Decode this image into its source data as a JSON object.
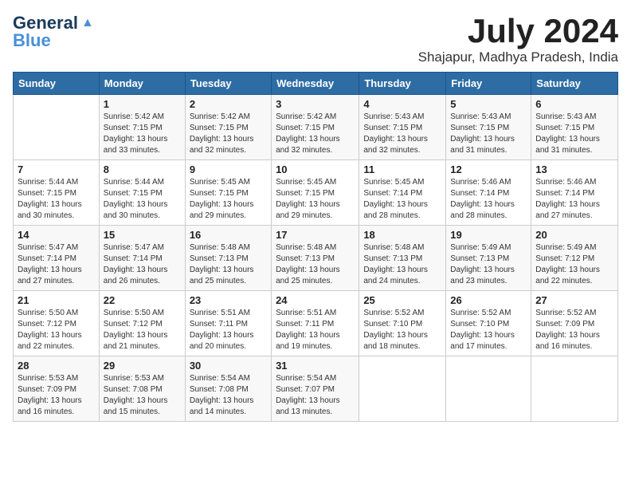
{
  "header": {
    "logo_general": "General",
    "logo_blue": "Blue",
    "month_year": "July 2024",
    "location": "Shajapur, Madhya Pradesh, India"
  },
  "weekdays": [
    "Sunday",
    "Monday",
    "Tuesday",
    "Wednesday",
    "Thursday",
    "Friday",
    "Saturday"
  ],
  "weeks": [
    [
      {
        "day": "",
        "info": ""
      },
      {
        "day": "1",
        "info": "Sunrise: 5:42 AM\nSunset: 7:15 PM\nDaylight: 13 hours\nand 33 minutes."
      },
      {
        "day": "2",
        "info": "Sunrise: 5:42 AM\nSunset: 7:15 PM\nDaylight: 13 hours\nand 32 minutes."
      },
      {
        "day": "3",
        "info": "Sunrise: 5:42 AM\nSunset: 7:15 PM\nDaylight: 13 hours\nand 32 minutes."
      },
      {
        "day": "4",
        "info": "Sunrise: 5:43 AM\nSunset: 7:15 PM\nDaylight: 13 hours\nand 32 minutes."
      },
      {
        "day": "5",
        "info": "Sunrise: 5:43 AM\nSunset: 7:15 PM\nDaylight: 13 hours\nand 31 minutes."
      },
      {
        "day": "6",
        "info": "Sunrise: 5:43 AM\nSunset: 7:15 PM\nDaylight: 13 hours\nand 31 minutes."
      }
    ],
    [
      {
        "day": "7",
        "info": "Sunrise: 5:44 AM\nSunset: 7:15 PM\nDaylight: 13 hours\nand 30 minutes."
      },
      {
        "day": "8",
        "info": "Sunrise: 5:44 AM\nSunset: 7:15 PM\nDaylight: 13 hours\nand 30 minutes."
      },
      {
        "day": "9",
        "info": "Sunrise: 5:45 AM\nSunset: 7:15 PM\nDaylight: 13 hours\nand 29 minutes."
      },
      {
        "day": "10",
        "info": "Sunrise: 5:45 AM\nSunset: 7:15 PM\nDaylight: 13 hours\nand 29 minutes."
      },
      {
        "day": "11",
        "info": "Sunrise: 5:45 AM\nSunset: 7:14 PM\nDaylight: 13 hours\nand 28 minutes."
      },
      {
        "day": "12",
        "info": "Sunrise: 5:46 AM\nSunset: 7:14 PM\nDaylight: 13 hours\nand 28 minutes."
      },
      {
        "day": "13",
        "info": "Sunrise: 5:46 AM\nSunset: 7:14 PM\nDaylight: 13 hours\nand 27 minutes."
      }
    ],
    [
      {
        "day": "14",
        "info": "Sunrise: 5:47 AM\nSunset: 7:14 PM\nDaylight: 13 hours\nand 27 minutes."
      },
      {
        "day": "15",
        "info": "Sunrise: 5:47 AM\nSunset: 7:14 PM\nDaylight: 13 hours\nand 26 minutes."
      },
      {
        "day": "16",
        "info": "Sunrise: 5:48 AM\nSunset: 7:13 PM\nDaylight: 13 hours\nand 25 minutes."
      },
      {
        "day": "17",
        "info": "Sunrise: 5:48 AM\nSunset: 7:13 PM\nDaylight: 13 hours\nand 25 minutes."
      },
      {
        "day": "18",
        "info": "Sunrise: 5:48 AM\nSunset: 7:13 PM\nDaylight: 13 hours\nand 24 minutes."
      },
      {
        "day": "19",
        "info": "Sunrise: 5:49 AM\nSunset: 7:13 PM\nDaylight: 13 hours\nand 23 minutes."
      },
      {
        "day": "20",
        "info": "Sunrise: 5:49 AM\nSunset: 7:12 PM\nDaylight: 13 hours\nand 22 minutes."
      }
    ],
    [
      {
        "day": "21",
        "info": "Sunrise: 5:50 AM\nSunset: 7:12 PM\nDaylight: 13 hours\nand 22 minutes."
      },
      {
        "day": "22",
        "info": "Sunrise: 5:50 AM\nSunset: 7:12 PM\nDaylight: 13 hours\nand 21 minutes."
      },
      {
        "day": "23",
        "info": "Sunrise: 5:51 AM\nSunset: 7:11 PM\nDaylight: 13 hours\nand 20 minutes."
      },
      {
        "day": "24",
        "info": "Sunrise: 5:51 AM\nSunset: 7:11 PM\nDaylight: 13 hours\nand 19 minutes."
      },
      {
        "day": "25",
        "info": "Sunrise: 5:52 AM\nSunset: 7:10 PM\nDaylight: 13 hours\nand 18 minutes."
      },
      {
        "day": "26",
        "info": "Sunrise: 5:52 AM\nSunset: 7:10 PM\nDaylight: 13 hours\nand 17 minutes."
      },
      {
        "day": "27",
        "info": "Sunrise: 5:52 AM\nSunset: 7:09 PM\nDaylight: 13 hours\nand 16 minutes."
      }
    ],
    [
      {
        "day": "28",
        "info": "Sunrise: 5:53 AM\nSunset: 7:09 PM\nDaylight: 13 hours\nand 16 minutes."
      },
      {
        "day": "29",
        "info": "Sunrise: 5:53 AM\nSunset: 7:08 PM\nDaylight: 13 hours\nand 15 minutes."
      },
      {
        "day": "30",
        "info": "Sunrise: 5:54 AM\nSunset: 7:08 PM\nDaylight: 13 hours\nand 14 minutes."
      },
      {
        "day": "31",
        "info": "Sunrise: 5:54 AM\nSunset: 7:07 PM\nDaylight: 13 hours\nand 13 minutes."
      },
      {
        "day": "",
        "info": ""
      },
      {
        "day": "",
        "info": ""
      },
      {
        "day": "",
        "info": ""
      }
    ]
  ]
}
